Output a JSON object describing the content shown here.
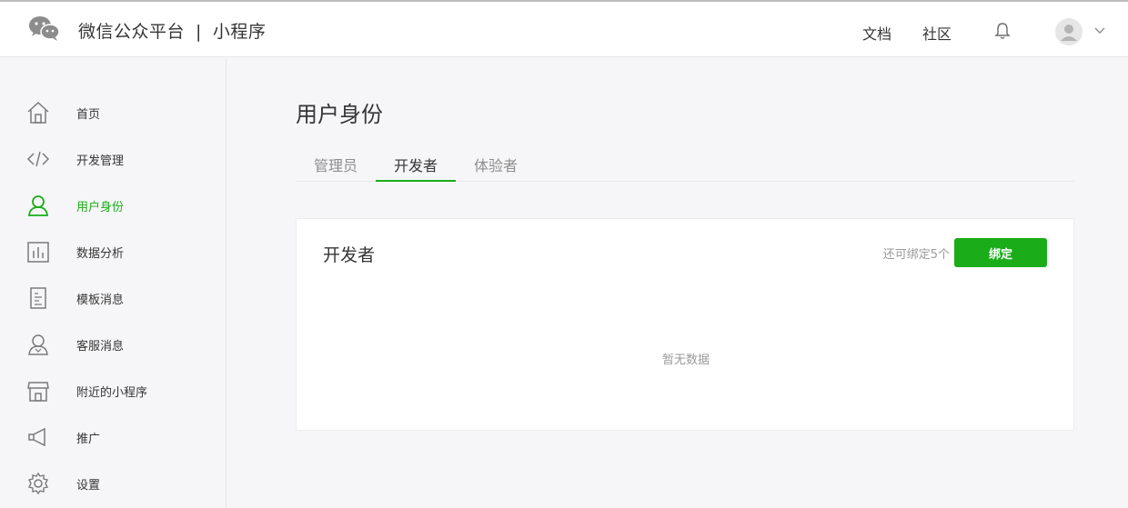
{
  "header": {
    "brand_main": "微信公众平台",
    "brand_sep": "|",
    "brand_sub": "小程序",
    "links": [
      {
        "label": "文档"
      },
      {
        "label": "社区"
      }
    ]
  },
  "sidebar": {
    "items": [
      {
        "label": "首页",
        "icon": "home-icon",
        "active": false
      },
      {
        "label": "开发管理",
        "icon": "code-icon",
        "active": false
      },
      {
        "label": "用户身份",
        "icon": "user-icon",
        "active": true
      },
      {
        "label": "数据分析",
        "icon": "chart-icon",
        "active": false
      },
      {
        "label": "模板消息",
        "icon": "document-icon",
        "active": false
      },
      {
        "label": "客服消息",
        "icon": "customer-service-icon",
        "active": false
      },
      {
        "label": "附近的小程序",
        "icon": "store-icon",
        "active": false
      },
      {
        "label": "推广",
        "icon": "megaphone-icon",
        "active": false
      },
      {
        "label": "设置",
        "icon": "gear-icon",
        "active": false
      }
    ]
  },
  "main": {
    "title": "用户身份",
    "tabs": [
      {
        "label": "管理员",
        "active": false
      },
      {
        "label": "开发者",
        "active": true
      },
      {
        "label": "体验者",
        "active": false
      }
    ],
    "card": {
      "title": "开发者",
      "quota": "还可绑定5个",
      "bind_label": "绑定",
      "empty_text": "暂无数据"
    }
  },
  "colors": {
    "accent": "#1aad19",
    "text": "#353535",
    "muted": "#9a9a9a",
    "background": "#f6f6f8"
  }
}
